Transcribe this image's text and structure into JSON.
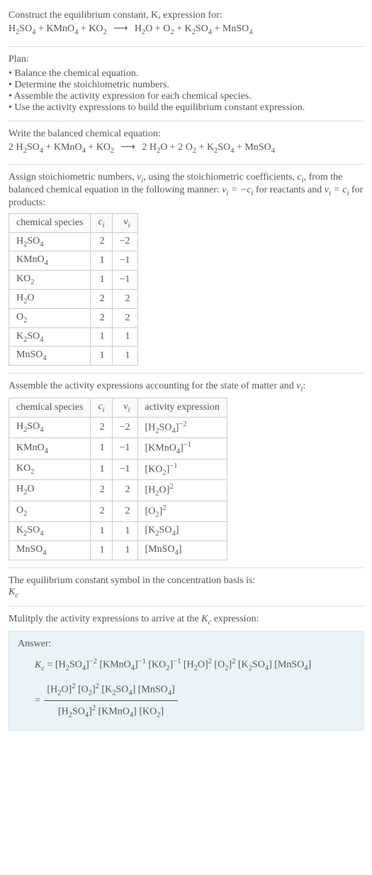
{
  "header": {
    "prompt": "Construct the equilibrium constant, K, expression for:",
    "equation_lhs": "H₂SO₄ + KMnO₄ + KO₂",
    "equation_rhs": "H₂O + O₂ + K₂SO₄ + MnSO₄"
  },
  "plan": {
    "title": "Plan:",
    "items": [
      "Balance the chemical equation.",
      "Determine the stoichiometric numbers.",
      "Assemble the activity expression for each chemical species.",
      "Use the activity expressions to build the equilibrium constant expression."
    ]
  },
  "balanced": {
    "title": "Write the balanced chemical equation:",
    "lhs": "2 H₂SO₄ + KMnO₄ + KO₂",
    "rhs": "2 H₂O + 2 O₂ + K₂SO₄ + MnSO₄"
  },
  "assign": {
    "text_a": "Assign stoichiometric numbers, ",
    "nu": "νᵢ",
    "text_b": ", using the stoichiometric coefficients, ",
    "ci": "cᵢ",
    "text_c": ", from the balanced chemical equation in the following manner: ",
    "rel1": "νᵢ = −cᵢ",
    "text_d": " for reactants and ",
    "rel2": "νᵢ = cᵢ",
    "text_e": " for products:"
  },
  "table1": {
    "headers": [
      "chemical species",
      "cᵢ",
      "νᵢ"
    ],
    "rows": [
      [
        "H₂SO₄",
        "2",
        "−2"
      ],
      [
        "KMnO₄",
        "1",
        "−1"
      ],
      [
        "KO₂",
        "1",
        "−1"
      ],
      [
        "H₂O",
        "2",
        "2"
      ],
      [
        "O₂",
        "2",
        "2"
      ],
      [
        "K₂SO₄",
        "1",
        "1"
      ],
      [
        "MnSO₄",
        "1",
        "1"
      ]
    ]
  },
  "activity_intro": "Assemble the activity expressions accounting for the state of matter and νᵢ:",
  "table2": {
    "headers": [
      "chemical species",
      "cᵢ",
      "νᵢ",
      "activity expression"
    ],
    "rows": [
      {
        "sp": "H₂SO₄",
        "c": "2",
        "v": "−2",
        "act": "[H₂SO₄]⁻²"
      },
      {
        "sp": "KMnO₄",
        "c": "1",
        "v": "−1",
        "act": "[KMnO₄]⁻¹"
      },
      {
        "sp": "KO₂",
        "c": "1",
        "v": "−1",
        "act": "[KO₂]⁻¹"
      },
      {
        "sp": "H₂O",
        "c": "2",
        "v": "2",
        "act": "[H₂O]²"
      },
      {
        "sp": "O₂",
        "c": "2",
        "v": "2",
        "act": "[O₂]²"
      },
      {
        "sp": "K₂SO₄",
        "c": "1",
        "v": "1",
        "act": "[K₂SO₄]"
      },
      {
        "sp": "MnSO₄",
        "c": "1",
        "v": "1",
        "act": "[MnSO₄]"
      }
    ]
  },
  "symbol": {
    "text": "The equilibrium constant symbol in the concentration basis is:",
    "kc": "K_c"
  },
  "multiply": "Mulitply the activity expressions to arrive at the K_c expression:",
  "answer": {
    "label": "Answer:",
    "kc_eq": "K_c = ",
    "line1": "[H₂SO₄]⁻² [KMnO₄]⁻¹ [KO₂]⁻¹ [H₂O]² [O₂]² [K₂SO₄] [MnSO₄]",
    "eq2": "= ",
    "frac_num": "[H₂O]² [O₂]² [K₂SO₄] [MnSO₄]",
    "frac_den": "[H₂SO₄]² [KMnO₄] [KO₂]"
  }
}
